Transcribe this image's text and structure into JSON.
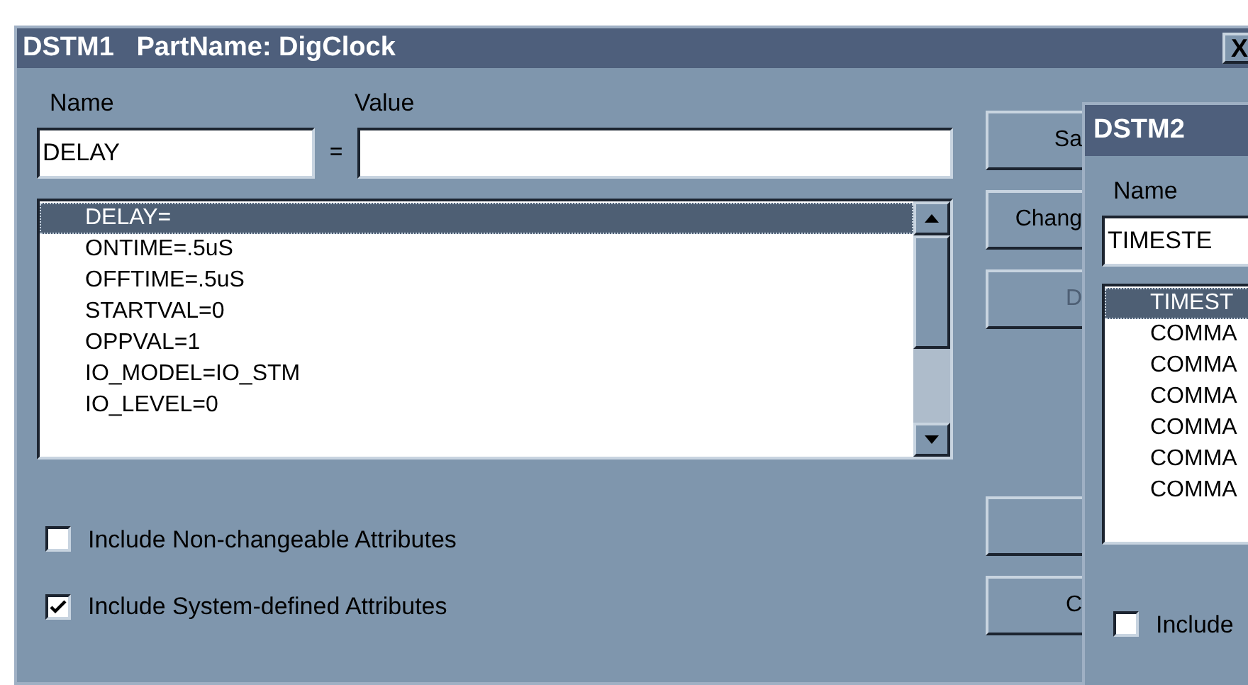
{
  "dialog": {
    "title": "DSTM1   PartName: DigClock",
    "close": "X",
    "name_label": "Name",
    "value_label": "Value",
    "name_value": "DELAY",
    "equals": "=",
    "attributes": [
      {
        "text": "DELAY=",
        "selected": true
      },
      {
        "text": "ONTIME=.5uS",
        "selected": false
      },
      {
        "text": "OFFTIME=.5uS",
        "selected": false
      },
      {
        "text": "STARTVAL=0",
        "selected": false
      },
      {
        "text": "OPPVAL=1",
        "selected": false
      },
      {
        "text": "IO_MODEL=IO_STM",
        "selected": false
      },
      {
        "text": "IO_LEVEL=0",
        "selected": false
      }
    ],
    "options": [
      {
        "label": "Include Non-changeable Attributes",
        "checked": false
      },
      {
        "label": "Include System-defined Attributes",
        "checked": true
      }
    ],
    "top_buttons": [
      {
        "label": "Sa",
        "disabled": false
      },
      {
        "label": "Chang",
        "disabled": false
      },
      {
        "label": "D",
        "disabled": true
      }
    ],
    "bottom_buttons": [
      {
        "label": "C"
      }
    ]
  },
  "dialog2": {
    "title": "DSTM2",
    "name_label": "Name",
    "name_value": "TIMESTE",
    "attributes": [
      {
        "text": "TIMEST",
        "selected": true
      },
      {
        "text": "COMMA",
        "selected": false
      },
      {
        "text": "COMMA",
        "selected": false
      },
      {
        "text": "COMMA",
        "selected": false
      },
      {
        "text": "COMMA",
        "selected": false
      },
      {
        "text": "COMMA",
        "selected": false
      },
      {
        "text": "COMMA",
        "selected": false
      }
    ],
    "options": [
      {
        "label": "Include",
        "checked": false
      }
    ]
  }
}
